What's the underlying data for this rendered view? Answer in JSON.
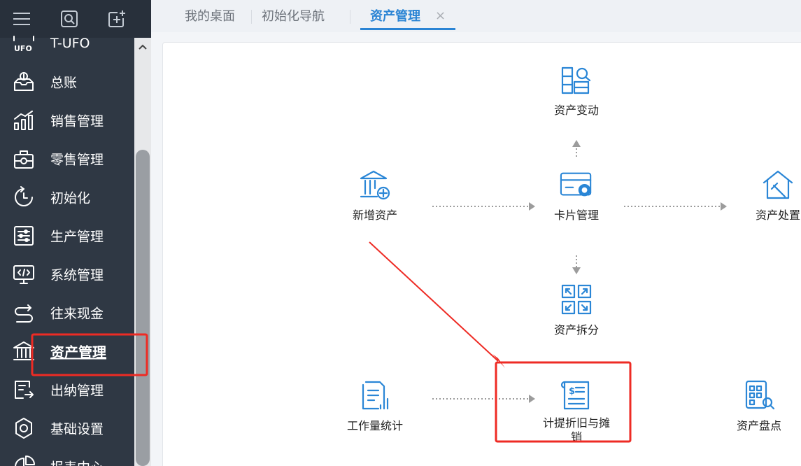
{
  "sidebar": {
    "items": [
      {
        "label": "T-UFO",
        "icon": "ufo-icon"
      },
      {
        "label": "总账",
        "icon": "ledger-icon"
      },
      {
        "label": "销售管理",
        "icon": "sales-chart-icon"
      },
      {
        "label": "零售管理",
        "icon": "retail-icon"
      },
      {
        "label": "初始化",
        "icon": "refresh-icon"
      },
      {
        "label": "生产管理",
        "icon": "sliders-icon"
      },
      {
        "label": "系统管理",
        "icon": "code-monitor-icon"
      },
      {
        "label": "往来现金",
        "icon": "exchange-icon"
      },
      {
        "label": "资产管理",
        "icon": "bank-icon"
      },
      {
        "label": "出纳管理",
        "icon": "cashier-icon"
      },
      {
        "label": "基础设置",
        "icon": "settings-icon"
      },
      {
        "label": "报表中心",
        "icon": "report-icon"
      }
    ],
    "active_index": 8
  },
  "tabs": [
    {
      "label": "我的桌面"
    },
    {
      "label": "初始化导航"
    },
    {
      "label": "资产管理",
      "active": true
    }
  ],
  "tab_close_symbol": "×",
  "flow": {
    "asset_change": "资产变动",
    "add_asset": "新增资产",
    "card_management": "卡片管理",
    "asset_disposal": "资产处置",
    "asset_split": "资产拆分",
    "workload_stats": "工作量统计",
    "depreciation": "计提折旧与摊销",
    "asset_inventory": "资产盘点"
  },
  "colors": {
    "sidebar_bg": "#2f3844",
    "accent": "#2a84d4",
    "highlight": "#ee2b24"
  }
}
